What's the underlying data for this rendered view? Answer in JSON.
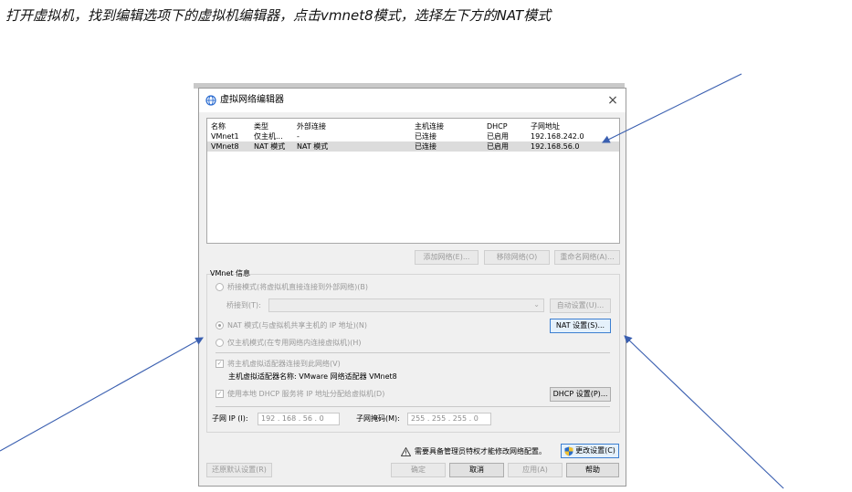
{
  "instruction": "打开虚拟机，找到编辑选项下的虚拟机编辑器，点击vmnet8模式，选择左下方的NAT模式",
  "dialog": {
    "title": "虚拟网络编辑器",
    "close_label": "×"
  },
  "table": {
    "headers": [
      "名称",
      "类型",
      "外部连接",
      "主机连接",
      "DHCP",
      "子网地址"
    ],
    "rows": [
      [
        "VMnet1",
        "仅主机...",
        "-",
        "已连接",
        "已启用",
        "192.168.242.0"
      ],
      [
        "VMnet8",
        "NAT 模式",
        "NAT 模式",
        "已连接",
        "已启用",
        "192.168.56.0"
      ]
    ],
    "selected_row": 1
  },
  "table_buttons": {
    "add": "添加网络(E)...",
    "remove": "移除网络(O)",
    "rename": "重命名网络(A)..."
  },
  "vmnet_info": {
    "group_label": "VMnet 信息",
    "bridged_label": "桥接模式(将虚拟机直接连接到外部网络)(B)",
    "bridge_to_label": "桥接到(T):",
    "bridge_to_value": "",
    "auto_settings": "自动设置(U)...",
    "nat_label": "NAT 模式(与虚拟机共享主机的 IP 地址)(N)",
    "nat_settings": "NAT 设置(S)...",
    "hostonly_label": "仅主机模式(在专用网络内连接虚拟机)(H)",
    "connect_adapter_label": "将主机虚拟适配器连接到此网络(V)",
    "adapter_name": "主机虚拟适配器名称: VMware 网络适配器 VMnet8",
    "dhcp_label": "使用本地 DHCP 服务将 IP 地址分配给虚拟机(D)",
    "dhcp_settings": "DHCP 设置(P)...",
    "subnet_ip_label": "子网 IP (I):",
    "subnet_ip_value": "192 . 168 .  56  .  0",
    "subnet_mask_label": "子网掩码(M):",
    "subnet_mask_value": "255 . 255 . 255 .  0"
  },
  "footer": {
    "admin_warning": "需要具备管理员特权才能修改网络配置。",
    "change_settings": "更改设置(C)",
    "restore_defaults": "还原默认设置(R)",
    "ok": "确定",
    "cancel": "取消",
    "apply": "应用(A)",
    "help": "帮助"
  },
  "colors": {
    "arrow": "#3a5fb0",
    "selected_row": "#dcdcdc",
    "primary_border": "#3c7fd1"
  }
}
